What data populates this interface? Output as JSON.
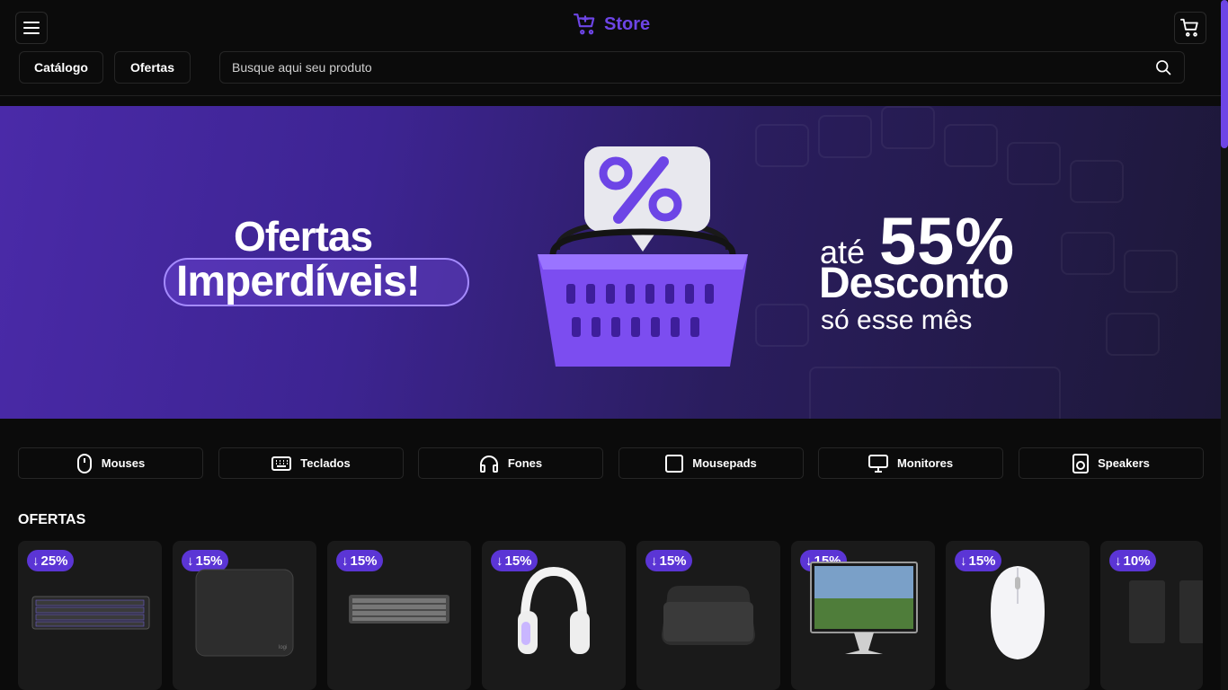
{
  "header": {
    "brand": "Store",
    "menu_icon": "menu-icon",
    "cart_icon": "cart-icon",
    "nav": [
      "Catálogo",
      "Ofertas"
    ],
    "search_placeholder": "Busque aqui seu produto"
  },
  "banner": {
    "line1": "Ofertas",
    "line2": "Imperdíveis!",
    "ate": "até",
    "percent": "55%",
    "desconto": "Desconto",
    "so": "só esse mês"
  },
  "categories": [
    {
      "label": "Mouses",
      "icon": "mouse-icon"
    },
    {
      "label": "Teclados",
      "icon": "keyboard-icon"
    },
    {
      "label": "Fones",
      "icon": "headphones-icon"
    },
    {
      "label": "Mousepads",
      "icon": "square-icon"
    },
    {
      "label": "Monitores",
      "icon": "monitor-icon"
    },
    {
      "label": "Speakers",
      "icon": "speaker-icon"
    }
  ],
  "offers": {
    "title": "OFERTAS",
    "items": [
      {
        "discount": "25%"
      },
      {
        "discount": "15%"
      },
      {
        "discount": "15%"
      },
      {
        "discount": "15%"
      },
      {
        "discount": "15%"
      },
      {
        "discount": "15%"
      },
      {
        "discount": "15%"
      },
      {
        "discount": "10%"
      }
    ]
  },
  "colors": {
    "accent": "#6d45e6",
    "badge": "#5b35d5",
    "background": "#0b0b0b",
    "card": "#1a1a1a"
  }
}
